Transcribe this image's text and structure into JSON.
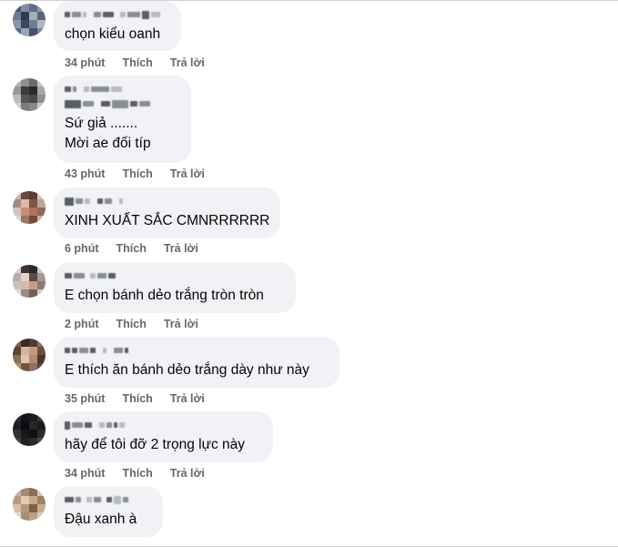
{
  "comments": [
    {
      "author_name": "",
      "lines": [
        "chọn kiểu oanh"
      ],
      "time": "34 phút",
      "like_label": "Thích",
      "reply_label": "Trả lời"
    },
    {
      "author_name": "",
      "lines": [
        "Sứ giả .......",
        "Mời ae đối típ"
      ],
      "time": "43 phút",
      "like_label": "Thích",
      "reply_label": "Trả lời"
    },
    {
      "author_name": "",
      "lines": [
        "XINH XUẤT SẮC CMNRRRRRR"
      ],
      "time": "6 phút",
      "like_label": "Thích",
      "reply_label": "Trả lời"
    },
    {
      "author_name": "",
      "lines": [
        "E chọn bánh dẻo trắng tròn tròn"
      ],
      "time": "2 phút",
      "like_label": "Thích",
      "reply_label": "Trả lời"
    },
    {
      "author_name": "",
      "lines": [
        "E thích ăn bánh dẻo trắng dày như này"
      ],
      "time": "35 phút",
      "like_label": "Thích",
      "reply_label": "Trả lời"
    },
    {
      "author_name": "",
      "lines": [
        "hãy để tôi đỡ 2 trọng lực này"
      ],
      "time": "34 phút",
      "like_label": "Thích",
      "reply_label": "Trả lời"
    },
    {
      "author_name": "",
      "lines": [
        "Đậu xanh à"
      ],
      "time": "",
      "like_label": "",
      "reply_label": ""
    }
  ],
  "colors": {
    "bubble_bg": "#f0f2f5",
    "meta_text": "#65676b",
    "comment_text": "#050505"
  }
}
